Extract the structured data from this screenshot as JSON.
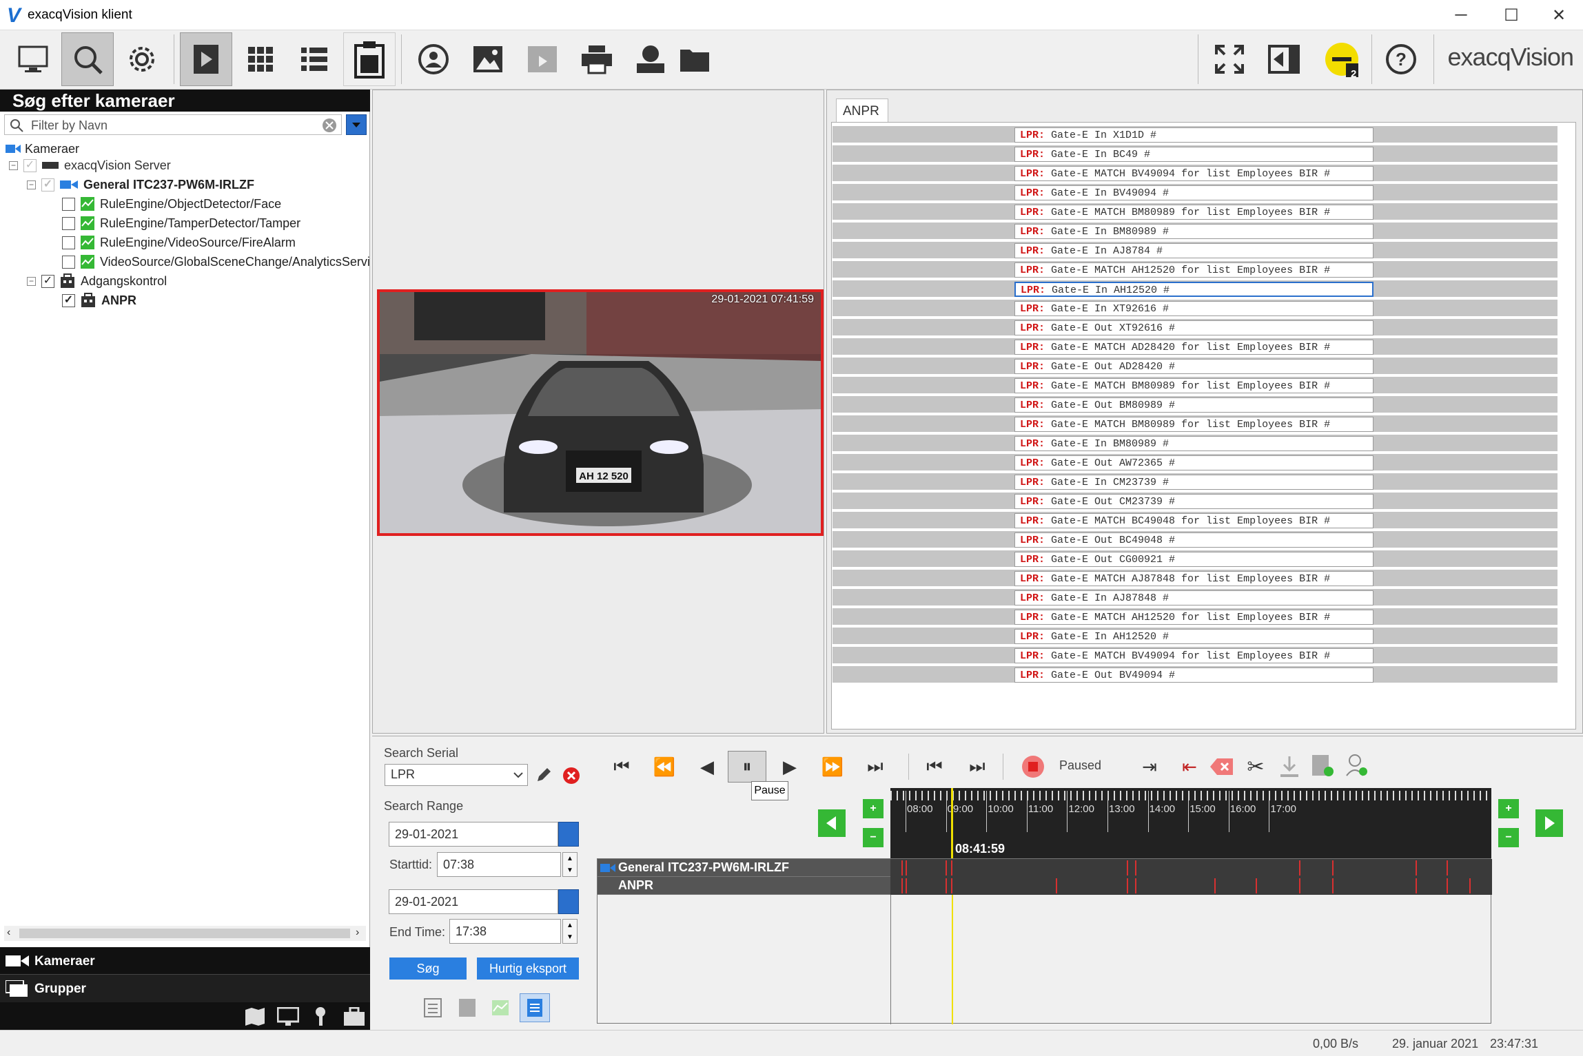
{
  "window": {
    "title": "exacqVision klient",
    "min": "─",
    "max": "☐",
    "close": "✕"
  },
  "toolbar": {
    "brand": "exacqVision",
    "notif_count": "2"
  },
  "left": {
    "heading": "Søg efter kameraer",
    "filter_placeholder": "Filter by Navn",
    "tree": {
      "root": "Kameraer",
      "server": "exacqVision Server",
      "camera": "General ITC237-PW6M-IRLZF",
      "events": [
        "RuleEngine/ObjectDetector/Face",
        "RuleEngine/TamperDetector/Tamper",
        "RuleEngine/VideoSource/FireAlarm",
        "VideoSource/GlobalSceneChange/AnalyticsService"
      ],
      "access": "Adgangskontrol",
      "anpr": "ANPR"
    },
    "nav": {
      "cameras": "Kameraer",
      "groups": "Grupper"
    }
  },
  "video": {
    "timestamp": "29-01-2021 07:41:59",
    "plate": "AH 12 520"
  },
  "anpr": {
    "tab": "ANPR",
    "rows": [
      " Gate-E In X1D1D #",
      " Gate-E In BC49 #",
      " Gate-E MATCH BV49094 for list Employees BIR #",
      " Gate-E In BV49094 #",
      " Gate-E MATCH BM80989 for list Employees BIR #",
      " Gate-E In BM80989 #",
      " Gate-E In AJ8784 #",
      " Gate-E MATCH AH12520 for list Employees BIR #",
      " Gate-E In AH12520 #",
      " Gate-E In XT92616 #",
      " Gate-E Out XT92616 #",
      " Gate-E MATCH AD28420 for list Employees BIR #",
      " Gate-E Out AD28420 #",
      " Gate-E MATCH BM80989 for list Employees BIR #",
      " Gate-E Out BM80989 #",
      " Gate-E MATCH BM80989 for list Employees BIR #",
      " Gate-E In BM80989 #",
      " Gate-E Out AW72365 #",
      " Gate-E In CM23739 #",
      " Gate-E Out CM23739 #",
      " Gate-E MATCH BC49048 for list Employees BIR #",
      " Gate-E Out BC49048 #",
      " Gate-E Out CG00921 #",
      " Gate-E MATCH AJ87848 for list Employees BIR #",
      " Gate-E In AJ87848 #",
      " Gate-E MATCH AH12520 for list Employees BIR #",
      " Gate-E In AH12520 #",
      " Gate-E MATCH BV49094 for list Employees BIR #",
      " Gate-E Out BV49094 #"
    ],
    "prefix": "LPR:",
    "selected_index": 8
  },
  "search": {
    "serial_label": "Search Serial",
    "serial_value": "LPR",
    "range_label": "Search Range",
    "start_date": "29-01-2021",
    "start_label": "Starttid:",
    "start_time": "07:38",
    "end_date": "29-01-2021",
    "end_label": "End Time:",
    "end_time": "17:38",
    "search_btn": "Søg",
    "export_btn": "Hurtig eksport"
  },
  "playback": {
    "state": "Paused",
    "tooltip": "Pause",
    "cursor_time": "08:41:59",
    "hours": [
      "08:00",
      "09:00",
      "10:00",
      "11:00",
      "12:00",
      "13:00",
      "14:00",
      "15:00",
      "16:00",
      "17:00"
    ],
    "tracks": [
      "General ITC237-PW6M-IRLZF",
      "ANPR"
    ]
  },
  "status": {
    "rate": "0,00 B/s",
    "date": "29. januar 2021",
    "time": "23:47:31"
  },
  "colors": {
    "accent": "#2a6fcc",
    "lpr": "#d01515",
    "green": "#35b835",
    "video_border": "#e02020"
  }
}
